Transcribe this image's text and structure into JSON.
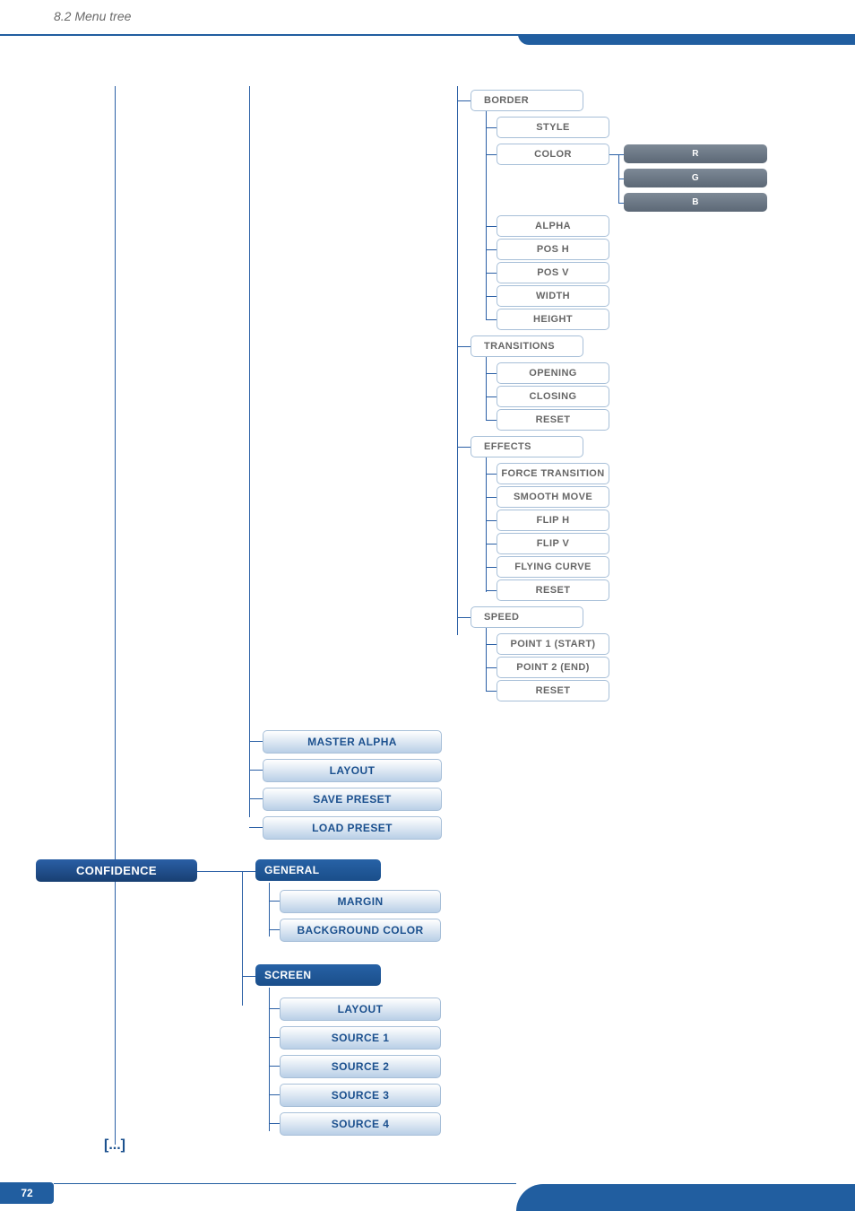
{
  "header": {
    "title": "8.2 Menu tree"
  },
  "page_number": "72",
  "continuation": "[...]",
  "tree": {
    "col3": {
      "border": {
        "label": "BORDER",
        "items": [
          "STYLE",
          "COLOR",
          "ALPHA",
          "POS H",
          "POS V",
          "WIDTH",
          "HEIGHT"
        ]
      },
      "rgb": [
        "R",
        "G",
        "B"
      ],
      "transitions": {
        "label": "TRANSITIONS",
        "items": [
          "OPENING",
          "CLOSING",
          "RESET"
        ]
      },
      "effects": {
        "label": "EFFECTS",
        "items": [
          "FORCE TRANSITION",
          "SMOOTH MOVE",
          "FLIP H",
          "FLIP V",
          "FLYING CURVE",
          "RESET"
        ]
      },
      "speed": {
        "label": "SPEED",
        "items": [
          "POINT 1 (START)",
          "POINT 2 (END)",
          "RESET"
        ]
      }
    },
    "col2_blue_strip": [
      "MASTER ALPHA",
      "LAYOUT",
      "SAVE PRESET",
      "LOAD PRESET"
    ],
    "confidence": {
      "root": "CONFIDENCE",
      "general": {
        "label": "GENERAL",
        "items": [
          "MARGIN",
          "BACKGROUND COLOR"
        ]
      },
      "screen": {
        "label": "SCREEN",
        "items": [
          "LAYOUT",
          "SOURCE 1",
          "SOURCE 2",
          "SOURCE 3",
          "SOURCE 4"
        ]
      }
    }
  }
}
